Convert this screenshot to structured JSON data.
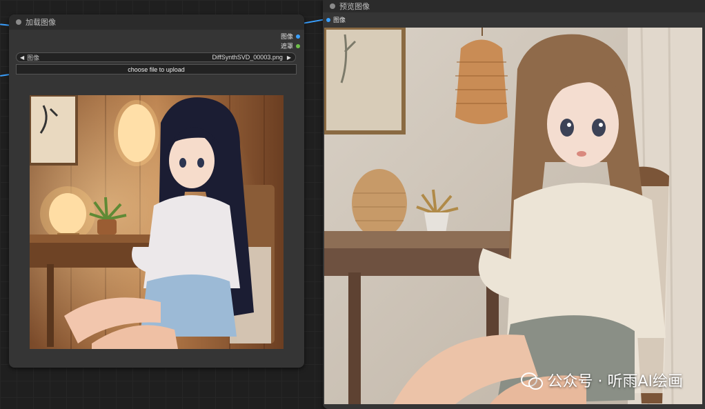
{
  "load_node": {
    "title": "加载图像",
    "outputs": [
      "图像",
      "遮罩"
    ],
    "image_widget": {
      "label": "图像",
      "value": "DiffSynthSVD_00003.png",
      "prev_icon": "triangle-left-icon",
      "next_icon": "triangle-right-icon"
    },
    "upload_label": "choose file to upload"
  },
  "preview_node": {
    "title": "预览图像",
    "input_label": "图像"
  },
  "watermark": {
    "text": "公众号 · 听雨AI绘画",
    "icon": "wechat-icon"
  },
  "colors": {
    "image_link": "#3aa0ff",
    "mask_port": "#6fbf4a",
    "node_bg": "#353535",
    "header_bg": "#2b2b2b",
    "canvas_bg": "#1f1f1f"
  }
}
